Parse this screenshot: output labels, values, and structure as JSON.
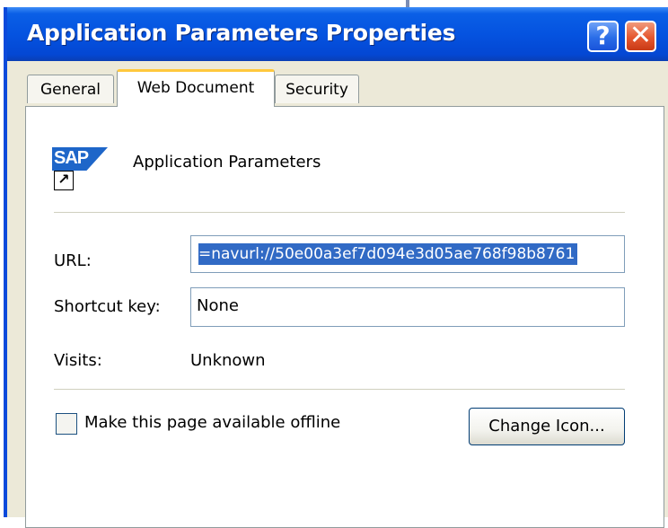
{
  "window": {
    "title": "Application Parameters Properties",
    "title_bar_color": "#0553e0",
    "help_button_label": "?",
    "close_button_label": "✕"
  },
  "tabs": [
    {
      "label": "General",
      "active": false
    },
    {
      "label": "Web Document",
      "active": true
    },
    {
      "label": "Security",
      "active": false
    }
  ],
  "header": {
    "icon": "sap-shortcut-icon",
    "logo_text": "SAP",
    "shortcut_glyph": "↗",
    "app_name": "Application Parameters"
  },
  "form": {
    "url": {
      "label": "URL:",
      "value": "=navurl://50e00a3ef7d094e3d05ae768f98b8761",
      "selected": true
    },
    "shortcut_key": {
      "label": "Shortcut key:",
      "value": "None"
    },
    "visits": {
      "label": "Visits:",
      "value": "Unknown"
    }
  },
  "offline": {
    "label": "Make this page available offline",
    "checked": false
  },
  "buttons": {
    "change_icon": "Change Icon..."
  }
}
